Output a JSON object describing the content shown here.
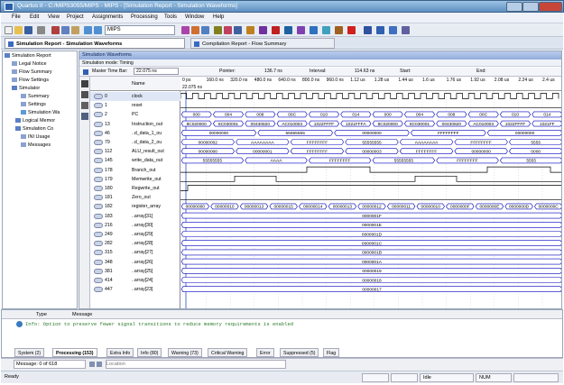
{
  "window": {
    "title": "Quartus II - C:/MIPS3055/MIPS - MIPS - [Simulation Report - Simulation Waveforms]"
  },
  "menu": [
    "File",
    "Edit",
    "View",
    "Project",
    "Assignments",
    "Processing",
    "Tools",
    "Window",
    "Help"
  ],
  "toolbar": {
    "project_combo": "MIPS"
  },
  "doc_tabs": {
    "active": "Simulation Report - Simulation Waveforms",
    "other": "Compilation Report - Flow Summary"
  },
  "tree": {
    "root": "Simulation Report",
    "items": [
      "Legal Notice",
      "Flow Summary",
      "Flow Settings"
    ],
    "group": "Simulator",
    "sub": [
      "Summary",
      "Settings",
      "Simulation Wa",
      "Logical Memor",
      "Simulation Co",
      "INI Usage",
      "Messages"
    ]
  },
  "sim": {
    "header": "Simulation Waveforms",
    "mode": "Simulation mode: Timing",
    "master_label": "Master Time Bar:",
    "master_value": "22.075 ns",
    "pointer_label": "Pointer:",
    "pointer_value": "136.7 ns",
    "interval_label": "Interval:",
    "interval_value": "114.63 ns",
    "start_label": "Start:",
    "end_label": "End:",
    "value_col": "Name",
    "cursor_label": "22.075 ns"
  },
  "ruler_ticks": [
    "0 ps",
    "160.0 ns",
    "320.0 ns",
    "480.0 ns",
    "640.0 ns",
    "800.0 ns",
    "960.0 ns",
    "1.12 us",
    "1.28 us",
    "1.44 us",
    "1.6 us",
    "1.76 us",
    "1.92 us",
    "2.08 us",
    "2.24 us",
    "2.4 us"
  ],
  "signals": [
    {
      "id": "0",
      "name": "clock",
      "kind": "clk"
    },
    {
      "id": "1",
      "name": "reset",
      "kind": "low"
    },
    {
      "id": "2",
      "name": "PC",
      "kind": "bus",
      "vals": [
        "000",
        "004",
        "008",
        "00C",
        "010",
        "014",
        "000",
        "004",
        "008",
        "00C",
        "010",
        "014"
      ]
    },
    {
      "id": "13",
      "name": "Instruction_out",
      "kind": "bus",
      "vals": [
        "8C020000",
        "8C030001",
        "00430820",
        "AC010003",
        "1022FFFF",
        "1021FFFA",
        "8C020000",
        "8C030001",
        "00430820",
        "AC010003",
        "1022FFFF",
        "1021FF"
      ]
    },
    {
      "id": "46",
      "name": "..d_data_1_ou",
      "kind": "bus",
      "vals": [
        "00000000",
        "55555555",
        "00000000",
        "FFFFFFFF",
        "00000000"
      ]
    },
    {
      "id": "79",
      "name": "..d_data_2_ou",
      "kind": "bus",
      "vals": [
        "00000002",
        "AAAAAAAA",
        "FFFFFFFF",
        "55555555",
        "AAAAAAAA",
        "FFFFFFFF",
        "5555"
      ]
    },
    {
      "id": "112",
      "name": "ALU_result_out",
      "kind": "bus",
      "vals": [
        "00000000",
        "00000001",
        "FFFFFFFF",
        "00000003",
        "FFFFFFFF",
        "00000000",
        "0000"
      ]
    },
    {
      "id": "145",
      "name": "write_data_out",
      "kind": "bus",
      "vals": [
        "55555555",
        "AAAA",
        "FFFFFFFF",
        "55555555",
        "FFFFFFFF",
        "5555"
      ]
    },
    {
      "id": "178",
      "name": "Branch_out",
      "kind": "pulse"
    },
    {
      "id": "179",
      "name": "Memwrite_out",
      "kind": "pulse2"
    },
    {
      "id": "180",
      "name": "Regwrite_out",
      "kind": "high"
    },
    {
      "id": "181",
      "name": "Zero_out",
      "kind": "low"
    },
    {
      "id": "182",
      "name": "register_array",
      "kind": "bus",
      "vals": [
        "00000000",
        "00000010",
        "00000013",
        "00000015",
        "00000014",
        "00000013",
        "00000012",
        "00000011",
        "00000010",
        "0000000F",
        "0000000E",
        "0000000D",
        "0000000C"
      ]
    },
    {
      "id": "183",
      "name": "..array[31]",
      "kind": "const",
      "val": "0000001F"
    },
    {
      "id": "216",
      "name": "..array[30]",
      "kind": "const",
      "val": "0000001E"
    },
    {
      "id": "249",
      "name": "..array[29]",
      "kind": "const",
      "val": "0000001D"
    },
    {
      "id": "282",
      "name": "..array[28]",
      "kind": "const",
      "val": "0000001C"
    },
    {
      "id": "315",
      "name": "..array[27]",
      "kind": "const",
      "val": "0000001B"
    },
    {
      "id": "348",
      "name": "..array[26]",
      "kind": "const",
      "val": "0000001A"
    },
    {
      "id": "381",
      "name": "..array[25]",
      "kind": "const",
      "val": "00000019"
    },
    {
      "id": "414",
      "name": "..array[24]",
      "kind": "const",
      "val": "00000018"
    },
    {
      "id": "447",
      "name": "..array[23]",
      "kind": "const",
      "val": "00000017"
    }
  ],
  "messages": {
    "col_type": "Type",
    "col_message": "Message",
    "line": "Info: Option to preserve fewer signal transitions to reduce memory requirements is enabled",
    "tabs": [
      "System (2)",
      "Processing (153)",
      "Extra Info",
      "Info (80)",
      "Warning (73)",
      "Critical Warning",
      "Error",
      "Suppressed (5)",
      "Flag"
    ],
    "count": "Message: 0 of 618",
    "location_placeholder": "Location"
  },
  "status": {
    "left": "Ready",
    "idle": "Idle",
    "num": "NUM"
  }
}
